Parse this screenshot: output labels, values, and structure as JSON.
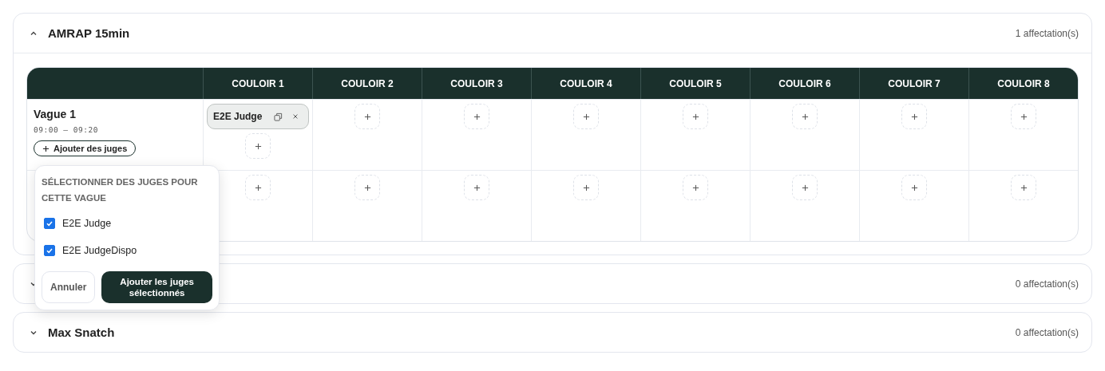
{
  "sections": [
    {
      "title": "AMRAP 15min",
      "count": "1 affectation(s)",
      "expanded": true,
      "lanes": [
        "COULOIR 1",
        "COULOIR 2",
        "COULOIR 3",
        "COULOIR 4",
        "COULOIR 5",
        "COULOIR 6",
        "COULOIR 7",
        "COULOIR 8"
      ],
      "rows": [
        {
          "label": "Vague 1",
          "time": "09:00 – 09:20",
          "add_button": "Ajouter des juges",
          "cells": [
            {
              "judges": [
                "E2E Judge"
              ]
            },
            {},
            {},
            {},
            {},
            {},
            {},
            {}
          ]
        },
        {
          "cells": [
            {},
            {},
            {},
            {},
            {},
            {},
            {},
            {}
          ]
        }
      ]
    },
    {
      "count": "0 affectation(s)",
      "expanded": false
    },
    {
      "title": "Max Snatch",
      "count": "0 affectation(s)",
      "expanded": false
    }
  ],
  "popover": {
    "title": "SÉLECTIONNER DES JUGES POUR CETTE VAGUE",
    "options": [
      {
        "label": "E2E Judge",
        "checked": true
      },
      {
        "label": "E2E JudgeDispo",
        "checked": true
      }
    ],
    "cancel": "Annuler",
    "confirm": "Ajouter les juges sélectionnés"
  }
}
